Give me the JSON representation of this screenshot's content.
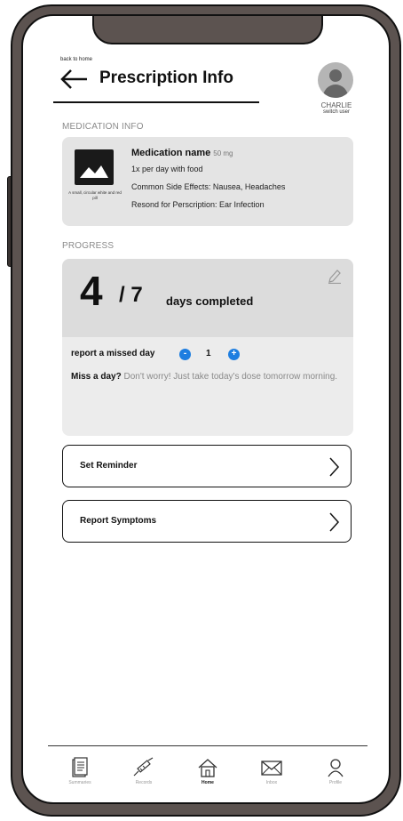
{
  "header": {
    "back_link": "back to home",
    "title": "Prescription Info",
    "user_name": "CHARLIE",
    "switch_user": "switch user"
  },
  "medication": {
    "section_label": "MEDICATION INFO",
    "name": "Medication name",
    "dose": "50 mg",
    "frequency": "1x per day with food",
    "side_effects": "Common Side Effects: Nausea, Headaches",
    "reason": "Resond for Perscription: Ear Infection",
    "image_caption": "A small, circular white and red pill"
  },
  "progress": {
    "section_label": "PROGRESS",
    "days_done": "4",
    "days_total": "/ 7",
    "days_label": "days completed",
    "missed_label": "report a missed day",
    "stepper_minus": "-",
    "stepper_plus": "+",
    "missed_count": "1",
    "miss_title": "Miss a day?",
    "miss_text": " Don't worry! Just take today's dose tomorrow morning."
  },
  "actions": {
    "set_reminder": "Set Reminder",
    "report_symptoms": "Report Symptoms"
  },
  "nav": {
    "items": [
      {
        "label": "Summaries",
        "icon": "document-icon"
      },
      {
        "label": "Records",
        "icon": "syringe-icon"
      },
      {
        "label": "Home",
        "icon": "home-icon"
      },
      {
        "label": "Inbox",
        "icon": "mail-icon"
      },
      {
        "label": "Profile",
        "icon": "person-icon"
      }
    ],
    "active": "Home"
  },
  "colors": {
    "frame": "#5c5350",
    "card": "#e4e4e4",
    "accent": "#1e7ee0"
  }
}
